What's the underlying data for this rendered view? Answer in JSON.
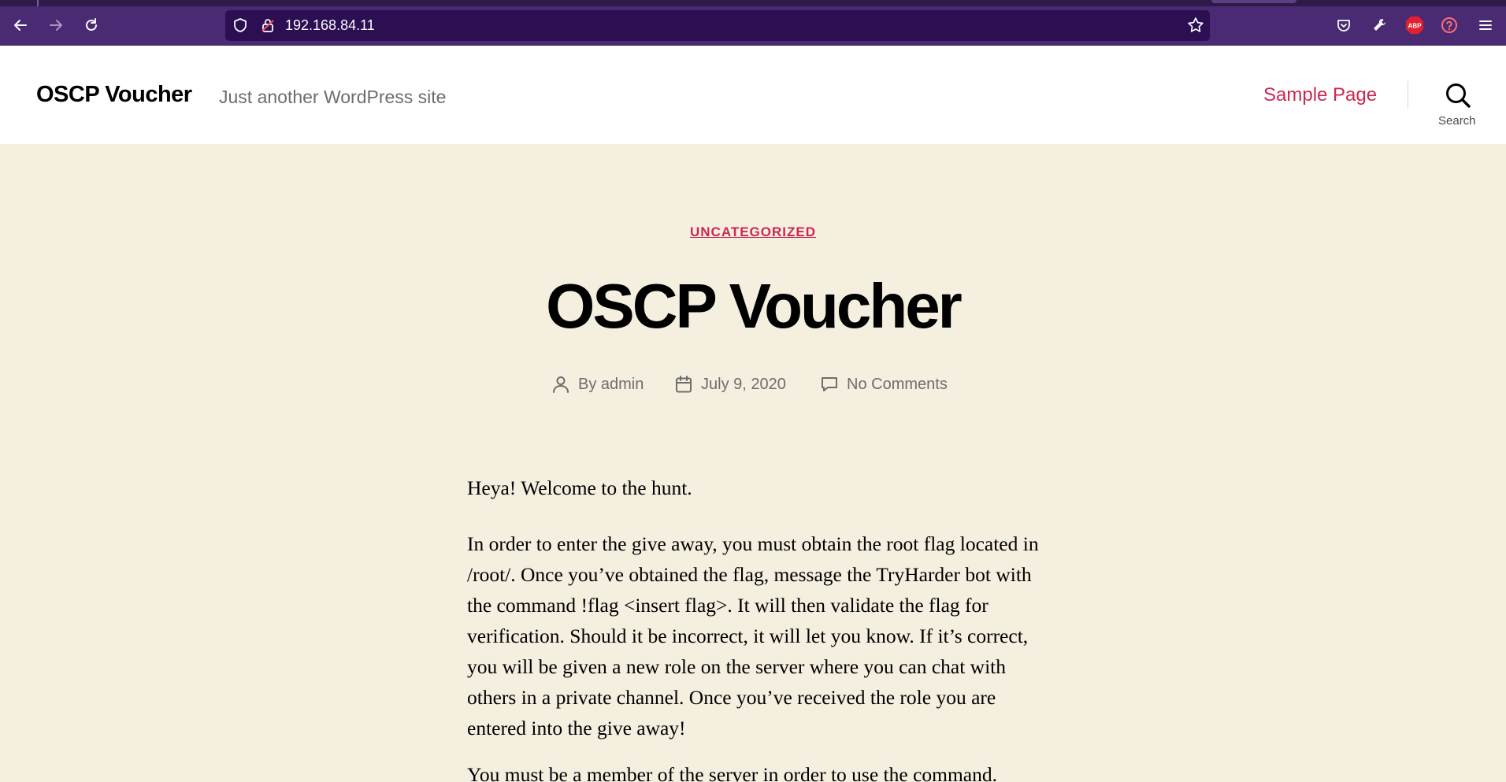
{
  "browser": {
    "url": "192.168.84.11",
    "icons": [
      "back-arrow-icon",
      "forward-arrow-icon",
      "reload-icon",
      "shield-icon",
      "lock-icon",
      "star-icon",
      "pocket-icon",
      "wrench-icon",
      "abp-icon",
      "help-icon",
      "menu-icon"
    ],
    "abp_label": "ABP"
  },
  "header": {
    "site_title": "OSCP Voucher",
    "site_description": "Just another WordPress site",
    "nav": [
      {
        "label": "Sample Page"
      }
    ],
    "search_label": "Search"
  },
  "post": {
    "category": "UNCATEGORIZED",
    "title": "OSCP Voucher",
    "author": "By admin",
    "date": "July 9, 2020",
    "comments": "No Comments",
    "paragraphs": [
      "Heya! Welcome to the hunt.",
      "In order to enter the give away, you must obtain the root flag located in /root/. Once you’ve obtained the flag, message the TryHarder bot with the command !flag <insert flag>. It will then validate the flag for verification. Should it be incorrect, it will let you know. If it’s correct, you will be given a new role on the server where you can chat with others in a private channel. Once you’ve received the role you are entered into the give away!",
      "You must be a member of the server in order to use the command."
    ]
  },
  "colors": {
    "accent": "#cd2653",
    "background": "#f5efe0",
    "chrome": "#4a2a72",
    "urlbar": "#2c0f52"
  }
}
